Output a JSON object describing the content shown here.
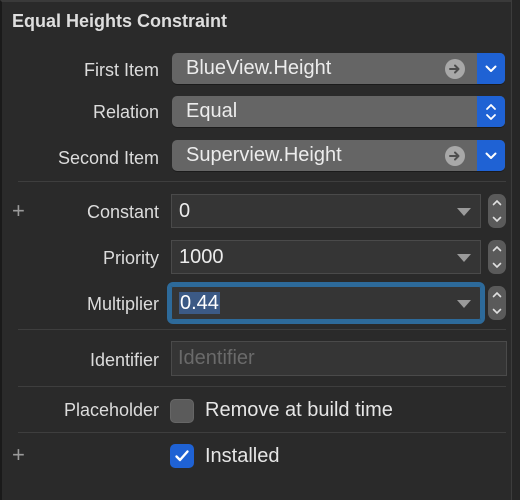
{
  "title": "Equal Heights Constraint",
  "colors": {
    "accent": "#1f62d4",
    "focus_ring": "#2d6a9a",
    "selection": "#3c5a85",
    "panel_bg": "#2a2a2a"
  },
  "first_item": {
    "label": "First Item",
    "value": "BlueView.Height",
    "goto_icon": "arrow-right-circle-icon",
    "menu_icon": "chevron-down-icon"
  },
  "relation": {
    "label": "Relation",
    "value": "Equal",
    "menu_icon": "chevron-up-down-icon"
  },
  "second_item": {
    "label": "Second Item",
    "value": "Superview.Height",
    "goto_icon": "arrow-right-circle-icon",
    "menu_icon": "chevron-down-icon"
  },
  "constant": {
    "label": "Constant",
    "value": "0"
  },
  "priority": {
    "label": "Priority",
    "value": "1000"
  },
  "multiplier": {
    "label": "Multiplier",
    "value": "0.44",
    "selected": true
  },
  "identifier": {
    "label": "Identifier",
    "value": "",
    "placeholder": "Identifier"
  },
  "placeholder_row": {
    "label": "Placeholder",
    "checkbox_label": "Remove at build time",
    "checked": false
  },
  "installed": {
    "checkbox_label": "Installed",
    "checked": true
  },
  "plus_symbol": "+"
}
